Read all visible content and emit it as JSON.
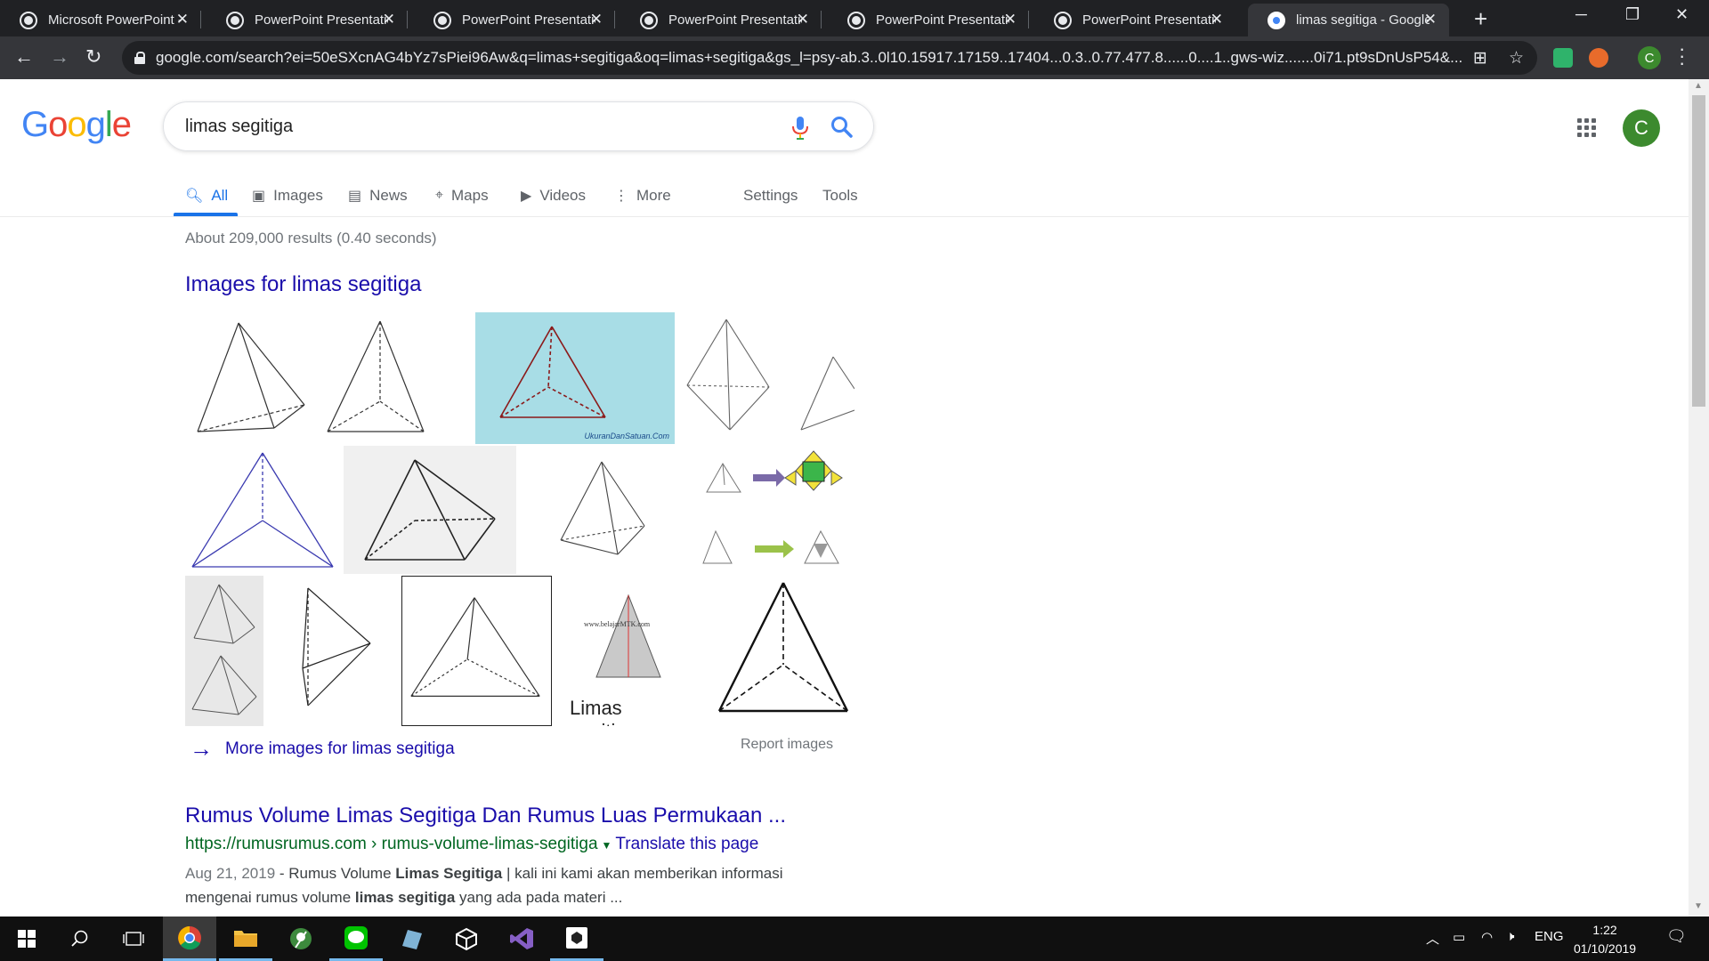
{
  "browser": {
    "tabs": [
      {
        "title": "Microsoft PowerPoint -",
        "active": false
      },
      {
        "title": "PowerPoint Presentatio",
        "active": false
      },
      {
        "title": "PowerPoint Presentatio",
        "active": false
      },
      {
        "title": "PowerPoint Presentatio",
        "active": false
      },
      {
        "title": "PowerPoint Presentatio",
        "active": false
      },
      {
        "title": "PowerPoint Presentatio",
        "active": false
      },
      {
        "title": "limas segitiga - Google",
        "active": true
      }
    ],
    "new_tab_label": "+",
    "url": "google.com/search?ei=50eSXcnAG4bYz7sPiei96Aw&q=limas+segitiga&oq=limas+segitiga&gs_l=psy-ab.3..0l10.15917.17159..17404...0.3..0.77.477.8......0....1..gws-wiz.......0i71.pt9sDnUsP54&...",
    "profile_initial": "C"
  },
  "google": {
    "logo_letters": [
      {
        "ch": "G",
        "color": "#4285F4"
      },
      {
        "ch": "o",
        "color": "#EA4335"
      },
      {
        "ch": "o",
        "color": "#FBBC05"
      },
      {
        "ch": "g",
        "color": "#4285F4"
      },
      {
        "ch": "l",
        "color": "#34A853"
      },
      {
        "ch": "e",
        "color": "#EA4335"
      }
    ],
    "query": "limas segitiga",
    "avatar_initial": "C",
    "tabs": {
      "all": "All",
      "images": "Images",
      "news": "News",
      "maps": "Maps",
      "videos": "Videos",
      "more": "More",
      "settings": "Settings",
      "tools": "Tools"
    },
    "result_stats": "About 209,000 results (0.40 seconds)",
    "images_heading": "Images for limas segitiga",
    "thumb_labels": {
      "watermark": "UkuranDanSatuan.Com",
      "belajar_site": "www.belajarMTK.com",
      "belajar_caption": "Limas segitiga"
    },
    "more_images": "More images for limas segitiga",
    "report_images": "Report images",
    "result": {
      "title": "Rumus Volume Limas Segitiga Dan Rumus Luas Permukaan ...",
      "url": "https://rumusrumus.com › rumus-volume-limas-segitiga",
      "translate": "Translate this page",
      "date": "Aug 21, 2019",
      "snippet_parts": [
        {
          "t": " - Rumus Volume ",
          "b": false
        },
        {
          "t": "Limas Segitiga",
          "b": true
        },
        {
          "t": " | kali ini kami akan memberikan informasi mengenai rumus volume ",
          "b": false
        },
        {
          "t": "limas segitiga",
          "b": true
        },
        {
          "t": " yang ada pada materi ...",
          "b": false
        }
      ]
    }
  },
  "taskbar": {
    "language": "ENG",
    "time": "1:22",
    "date": "01/10/2019"
  }
}
